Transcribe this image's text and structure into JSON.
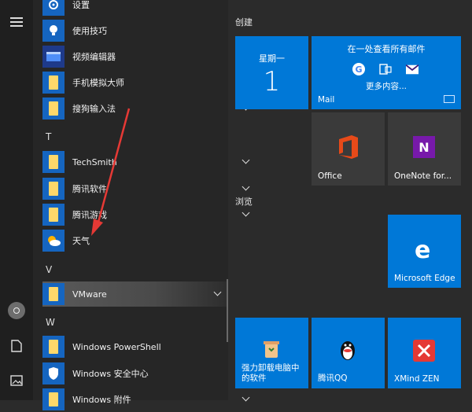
{
  "app_list": {
    "items": [
      {
        "label": "设置",
        "icon": "gear-icon",
        "expandable": false
      },
      {
        "label": "使用技巧",
        "icon": "tips-lightbulb-icon",
        "expandable": false
      },
      {
        "label": "视频编辑器",
        "icon": "video-editor-icon",
        "expandable": false
      },
      {
        "label": "手机模拟大师",
        "icon": "folder-icon",
        "expandable": true
      },
      {
        "label": "搜狗输入法",
        "icon": "folder-icon",
        "expandable": true
      }
    ],
    "section_t": "T",
    "t_items": [
      {
        "label": "TechSmith",
        "icon": "folder-icon",
        "expandable": true
      },
      {
        "label": "腾讯软件",
        "icon": "folder-icon",
        "expandable": true
      },
      {
        "label": "腾讯游戏",
        "icon": "folder-icon",
        "expandable": true
      },
      {
        "label": "天气",
        "icon": "weather-icon",
        "expandable": false
      }
    ],
    "section_v": "V",
    "v_items": [
      {
        "label": "VMware",
        "icon": "folder-icon",
        "expandable": true,
        "selected": true
      }
    ],
    "section_w": "W",
    "w_items": [
      {
        "label": "Windows PowerShell",
        "icon": "folder-icon",
        "expandable": true
      },
      {
        "label": "Windows 安全中心",
        "icon": "shield-icon",
        "expandable": false
      },
      {
        "label": "Windows 附件",
        "icon": "folder-icon",
        "expandable": true
      }
    ]
  },
  "tiles": {
    "group_create": "创建",
    "calendar": {
      "day": "星期一",
      "date": "1"
    },
    "mail": {
      "top_text": "在一处查看所有邮件",
      "more_text": "更多内容...",
      "label": "Mail"
    },
    "office": {
      "label": "Office"
    },
    "onenote": {
      "label": "OneNote for..."
    },
    "group_browse": "浏览",
    "edge": {
      "label": "Microsoft Edge"
    },
    "uninstall": {
      "label": "强力卸载电脑中的软件"
    },
    "qq": {
      "label": "腾讯QQ"
    },
    "xmind": {
      "label": "XMind ZEN"
    }
  },
  "colors": {
    "tile_blue": "#0078d7",
    "annotation_red": "#e53935"
  }
}
